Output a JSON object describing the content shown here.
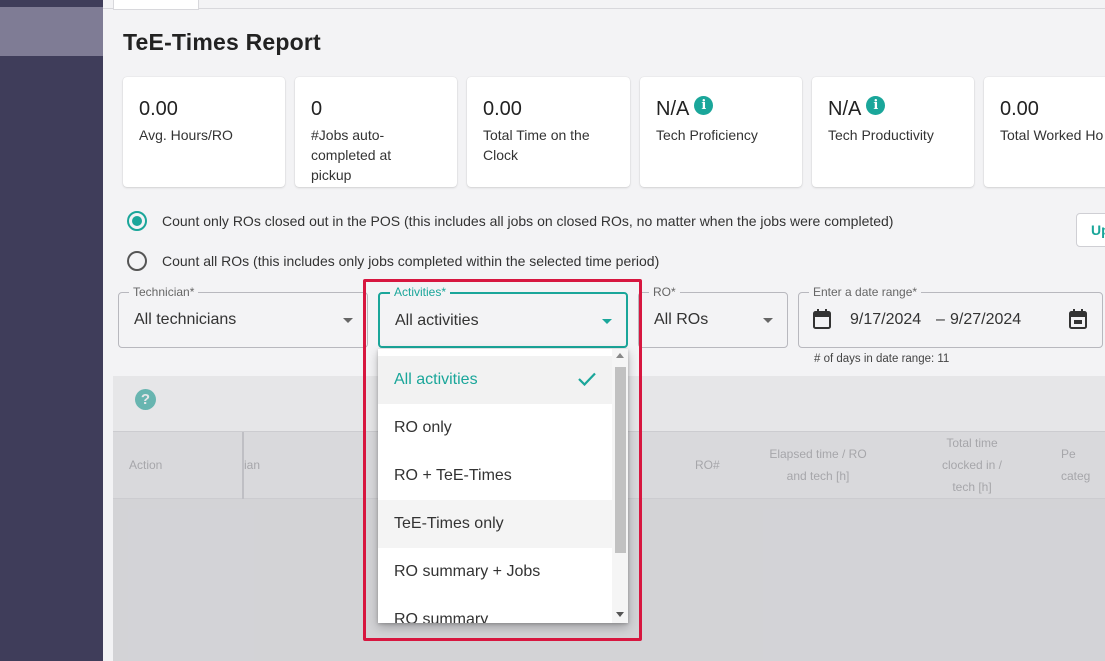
{
  "page": {
    "title": "TeE-Times Report"
  },
  "colors": {
    "accent": "#1aa69a",
    "sidebar": "#3f3d5a",
    "highlight": "#d7163f"
  },
  "stats": [
    {
      "value": "0.00",
      "label": "Avg. Hours/RO"
    },
    {
      "value": "0",
      "label": "#Jobs auto-completed at pickup"
    },
    {
      "value": "0.00",
      "label": "Total Time on the Clock"
    },
    {
      "value": "N/A",
      "label": "Tech Proficiency",
      "info_icon": "info-icon"
    },
    {
      "value": "N/A",
      "label": "Tech Productivity",
      "info_icon": "info-icon"
    },
    {
      "value": "0.00",
      "label": "Total Worked Ho"
    }
  ],
  "info_glyph": "i",
  "count_options": {
    "closed_only": "Count only ROs closed out in the POS (this includes all jobs on closed ROs, no matter when the jobs were completed)",
    "all_ros": "Count all ROs (this includes only jobs completed within the selected time period)",
    "selected": "closed_only"
  },
  "update_button": "Up",
  "filters": {
    "technician": {
      "label": "Technician*",
      "value": "All technicians"
    },
    "activities": {
      "label": "Activities*",
      "value": "All activities"
    },
    "ro": {
      "label": "RO*",
      "value": "All ROs"
    },
    "date_range": {
      "label": "Enter a date range*",
      "start": "9/17/2024",
      "separator": "–",
      "end": "9/27/2024",
      "days_note": "# of days in date range: 11"
    }
  },
  "help_glyph": "?",
  "table": {
    "columns": [
      "Action",
      "ian",
      "RO#",
      "Elapsed time / RO and tech [h]",
      "Total time clocked in / tech [h]",
      "Pe categ"
    ]
  },
  "activities_dropdown": {
    "selected": "All activities",
    "options": [
      "All activities",
      "RO only",
      "RO + TeE-Times",
      "TeE-Times only",
      "RO summary + Jobs",
      "RO summary"
    ]
  }
}
